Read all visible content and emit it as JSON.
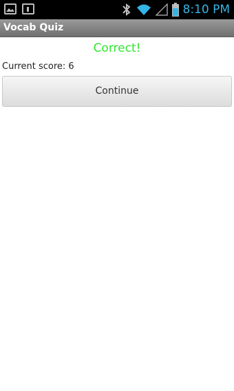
{
  "status_bar": {
    "time": "8:10 PM",
    "time_color": "#33b5e5",
    "icons": [
      "gallery-notification-icon",
      "calendar-notification-icon",
      "bluetooth-icon",
      "wifi-icon",
      "signal-icon",
      "battery-icon"
    ]
  },
  "app": {
    "title": "Vocab Quiz"
  },
  "main": {
    "result_message": "Correct!",
    "result_color": "#2ee62e",
    "score_text": "Current score: 6",
    "continue_label": "Continue"
  }
}
